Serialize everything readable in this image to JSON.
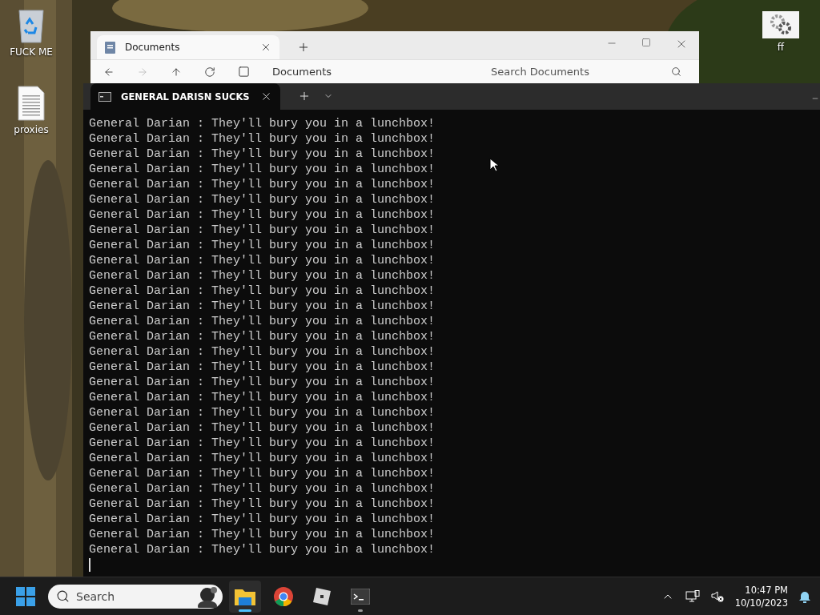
{
  "desktop_icons": [
    {
      "kind": "recycle",
      "label": "FUCK ME"
    },
    {
      "kind": "document",
      "label": "proxies"
    },
    {
      "kind": "settings",
      "label": "ff"
    }
  ],
  "explorer": {
    "tab": {
      "title": "Documents"
    },
    "breadcrumb": "Documents",
    "search": {
      "placeholder": "Search Documents"
    }
  },
  "terminal": {
    "tab": {
      "title": "GENERAL DARISN SUCKS"
    },
    "lines": [
      "General Darian : They'll bury you in a lunchbox!",
      "General Darian : They'll bury you in a lunchbox!",
      "General Darian : They'll bury you in a lunchbox!",
      "General Darian : They'll bury you in a lunchbox!",
      "General Darian : They'll bury you in a lunchbox!",
      "General Darian : They'll bury you in a lunchbox!",
      "General Darian : They'll bury you in a lunchbox!",
      "General Darian : They'll bury you in a lunchbox!",
      "General Darian : They'll bury you in a lunchbox!",
      "General Darian : They'll bury you in a lunchbox!",
      "General Darian : They'll bury you in a lunchbox!",
      "General Darian : They'll bury you in a lunchbox!",
      "General Darian : They'll bury you in a lunchbox!",
      "General Darian : They'll bury you in a lunchbox!",
      "General Darian : They'll bury you in a lunchbox!",
      "General Darian : They'll bury you in a lunchbox!",
      "General Darian : They'll bury you in a lunchbox!",
      "General Darian : They'll bury you in a lunchbox!",
      "General Darian : They'll bury you in a lunchbox!",
      "General Darian : They'll bury you in a lunchbox!",
      "General Darian : They'll bury you in a lunchbox!",
      "General Darian : They'll bury you in a lunchbox!",
      "General Darian : They'll bury you in a lunchbox!",
      "General Darian : They'll bury you in a lunchbox!",
      "General Darian : They'll bury you in a lunchbox!",
      "General Darian : They'll bury you in a lunchbox!",
      "General Darian : They'll bury you in a lunchbox!",
      "General Darian : They'll bury you in a lunchbox!",
      "General Darian : They'll bury you in a lunchbox!"
    ]
  },
  "taskbar": {
    "search": {
      "placeholder": "Search"
    },
    "apps": [
      {
        "kind": "folder",
        "selected": true,
        "running": true
      },
      {
        "kind": "chrome",
        "selected": false,
        "running": false
      },
      {
        "kind": "roblox",
        "selected": false,
        "running": false
      },
      {
        "kind": "terminal",
        "selected": false,
        "running": true
      }
    ],
    "clock": {
      "time": "10:47 PM",
      "date": "10/10/2023"
    }
  }
}
